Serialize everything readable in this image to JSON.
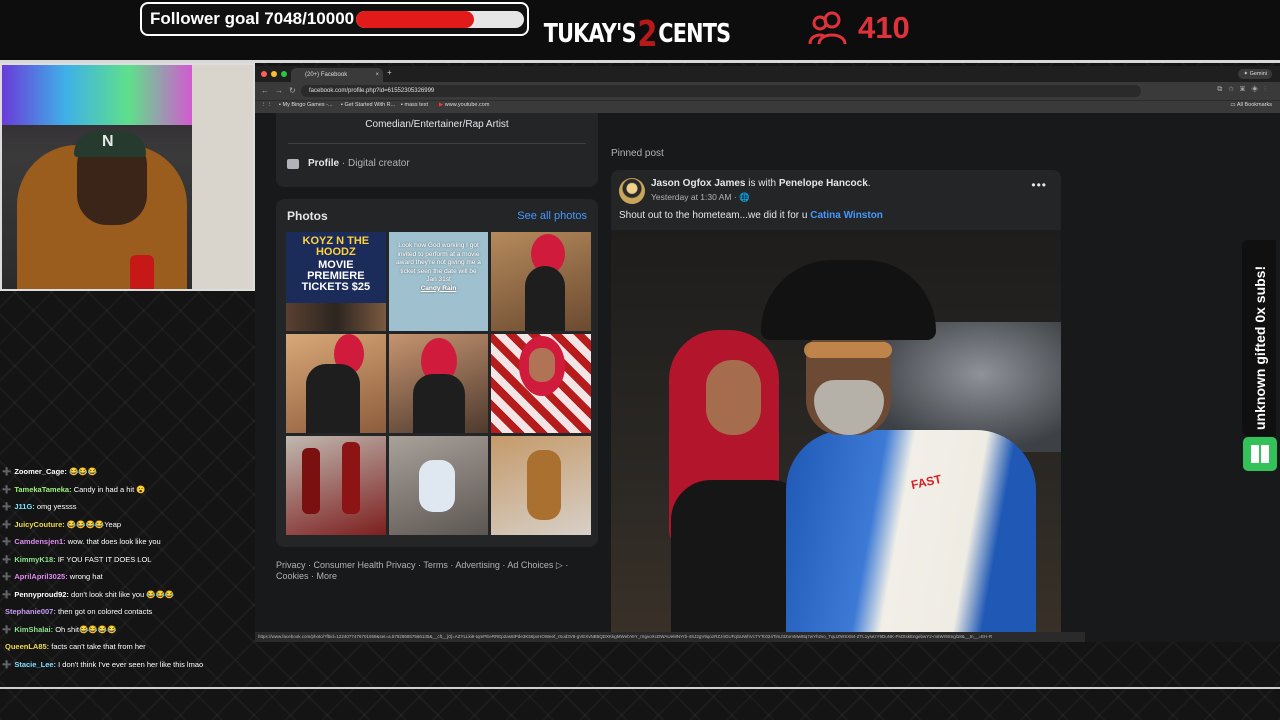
{
  "overlay": {
    "follower_goal_text": "Follower goal 7048/10000",
    "follower_goal_current": 7048,
    "follower_goal_target": 10000,
    "logo_text_left": "TUKAY'S",
    "logo_text_number": "2",
    "logo_text_right": "CENTS",
    "viewer_count": "410",
    "subs_text": "unknown gifted 0x subs!",
    "accent_red": "#e0323a",
    "subs_green": "#35c15a"
  },
  "chat": [
    {
      "icon": "➕",
      "user": "Zoomer_Cage:",
      "user_color": "#ffffff",
      "text": "😂😂😂"
    },
    {
      "icon": "➕",
      "user": "TamekaTameka:",
      "user_color": "#9cf27a",
      "text": "Candy in had a hit 😮"
    },
    {
      "icon": "➕",
      "user": "J11G:",
      "user_color": "#7ee0ff",
      "text": "omg yessss"
    },
    {
      "icon": "➕",
      "user": "JuicyCouture:",
      "user_color": "#f0d84a",
      "text": "😂😂😂😂Yeap"
    },
    {
      "icon": "➕",
      "user": "Camdensjen1:",
      "user_color": "#e08af0",
      "text": "wow. that does look like you"
    },
    {
      "icon": "➕",
      "user": "KimmyK18:",
      "user_color": "#8fe38f",
      "text": "IF YOU FAST IT DOES LOL"
    },
    {
      "icon": "➕",
      "user": "AprilApril3025:",
      "user_color": "#e08af0",
      "text": "wrong hat"
    },
    {
      "icon": "➕",
      "user": "Pennyproud92:",
      "user_color": "#ffffff",
      "text": "don't look shit like you 😂😂😂"
    },
    {
      "icon": "",
      "user": "Stephanie007:",
      "user_color": "#c89cf5",
      "text": "then got on colored contacts"
    },
    {
      "icon": "➕",
      "user": "KimShalai:",
      "user_color": "#8fe38f",
      "text": "Oh shit😂😂😂😂"
    },
    {
      "icon": "",
      "user": "QueenLA85:",
      "user_color": "#f0d84a",
      "text": "facts can't take that from her"
    },
    {
      "icon": "➕",
      "user": "Stacie_Lee:",
      "user_color": "#7ee0ff",
      "text": "I don't think I've ever seen her like this lmao"
    }
  ],
  "browser": {
    "tab_title": "(20+) Facebook",
    "gemini_label": "Gemini",
    "url": "facebook.com/profile.php?id=61552305326999",
    "bookmarks": [
      "My Bingo Games -...",
      "Get Started With R...",
      "mass text",
      "www.youtube.com"
    ],
    "all_bookmarks": "All Bookmarks",
    "status_url": "https://www.facebook.com/photo/?fbid=1224077476701659&set=a.579286857566135&__cft__[0]=AZYLLki9-tqmPEeRREp2as6IPde3K56pxHOWeef_rSod3V8-gVEXvNB5QDXKkgMWebYeY_IXgvoXcDWAUeMNYrb-4SJ2gV9qozRZJ4GUFqSUWhVcTYTc024TimJ3ZomMw8tq7wYh2vo_TqLtZWSX84-ZTL1ysezY9DuNK-PsOtskEngebwY2-m6Wr9Sngl18&__tn__=EH-R"
  },
  "intro": {
    "bio": "Comedian/Entertainer/Rap Artist",
    "profile_label": "Profile",
    "profile_type": " · Digital creator"
  },
  "photos": {
    "title": "Photos",
    "see_all": "See all photos",
    "tile1_title": "KOYZ N THE HOODZ",
    "tile1_tickets": "MOVIE PREMIERE TICKETS $25",
    "tile2_text": "Look how God working I got invited to perform at a movie award they're not giving me a ticket seen the date will be Jan 31st",
    "tile2_name": "Candy Rain"
  },
  "footer": {
    "links": "Privacy · Consumer Health Privacy · Terms · Advertising · Ad Choices ▷ · Cookies · More"
  },
  "post": {
    "pinned_label": "Pinned post",
    "author": "Jason Ogfox James",
    "with_text": " is with ",
    "tagged": "Penelope Hancock",
    "period": ".",
    "time": "Yesterday at 1:30 AM · 🌐",
    "more": "•••",
    "caption": "Shout out to the hometeam...we did it for u ",
    "caption_mention": "Catina Winston",
    "jacket_text": "FAST"
  }
}
